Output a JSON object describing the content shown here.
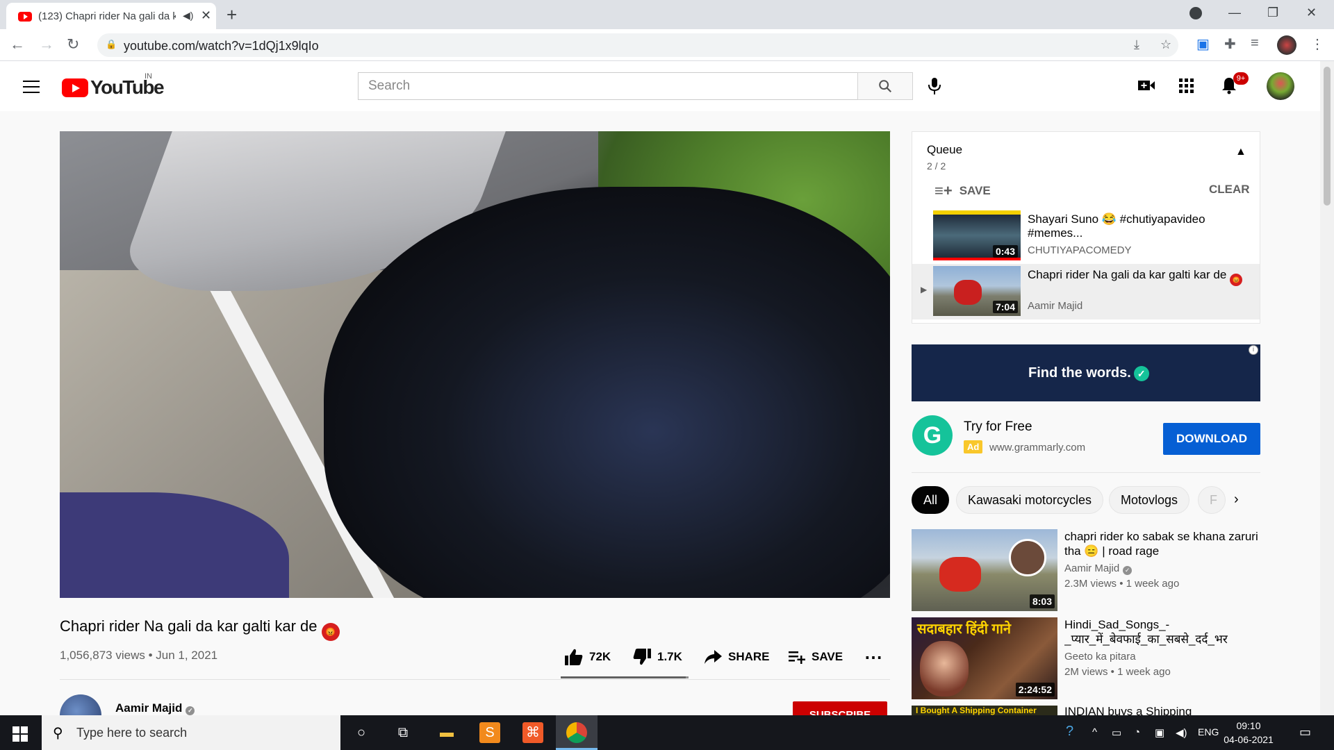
{
  "browser": {
    "tab_title": "(123) Chapri rider Na gali da kar galti kar de",
    "url": "youtube.com/watch?v=1dQj1x9lqIo"
  },
  "header": {
    "logo_text": "YouTube",
    "country": "IN",
    "search_placeholder": "Search",
    "notification_badge": "9+"
  },
  "video": {
    "title": "Chapri rider Na gali da kar galti kar de",
    "views": "1,056,873 views",
    "date": "Jun 1, 2021",
    "meta": "1,056,873 views • Jun 1, 2021",
    "likes": "72K",
    "dislikes": "1.7K",
    "like_fraction": 0.977,
    "share_label": "SHARE",
    "save_label": "SAVE",
    "channel": "Aamir Majid",
    "subscribe_label": "SUBSCRIBE"
  },
  "queue": {
    "title": "Queue",
    "count": "2 / 2",
    "save_label": "SAVE",
    "clear_label": "CLEAR",
    "items": [
      {
        "title": "Shayari Suno 😂 #chutiyapavideo #memes...",
        "channel": "CHUTIYAPACOMEDY",
        "duration": "0:43"
      },
      {
        "title": "Chapri rider Na gali da kar galti kar de",
        "channel": "Aamir Majid",
        "duration": "7:04"
      }
    ]
  },
  "ad": {
    "banner_text": "Find the words.",
    "headline": "Try for Free",
    "tag": "Ad",
    "domain": "www.grammarly.com",
    "cta": "DOWNLOAD",
    "logo_letter": "G"
  },
  "chips": [
    "All",
    "Kawasaki motorcycles",
    "Motovlogs",
    "F"
  ],
  "related": [
    {
      "title": "chapri rider ko sabak se khana zaruri tha 😑 | road rage",
      "channel": "Aamir Majid",
      "verified": true,
      "meta": "2.3M views • 1 week ago",
      "duration": "8:03"
    },
    {
      "title": "Hindi_Sad_Songs_-_प्यार_में_बेवफाई_का_सबसे_दर्द_भर",
      "channel": "Geeto ka pitara",
      "verified": false,
      "meta": "2M views • 1 week ago",
      "duration": "2:24:52",
      "thumb_text": "सदाबहार हिंदी गाने"
    },
    {
      "title": "INDIAN buys a Shipping",
      "thumb_text": "I Bought A Shipping Container"
    }
  ],
  "taskbar": {
    "search_placeholder": "Type here to search",
    "lang": "ENG",
    "time": "09:10",
    "date": "04-06-2021"
  },
  "colors": {
    "youtube_red": "#ff0000",
    "subscribe_red": "#cc0000",
    "download_blue": "#065fd4",
    "grammarly_green": "#15c39a",
    "ad_banner": "#15264a"
  }
}
